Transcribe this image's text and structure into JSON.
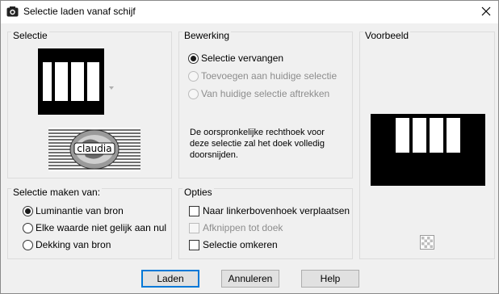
{
  "window": {
    "title": "Selectie laden vanaf schijf"
  },
  "groups": {
    "selectie": {
      "label": "Selectie"
    },
    "bewerking": {
      "label": "Bewerking",
      "options": [
        {
          "label": "Selectie vervangen",
          "checked": true,
          "disabled": false
        },
        {
          "label": "Toevoegen aan huidige selectie",
          "checked": false,
          "disabled": true
        },
        {
          "label": "Van huidige selectie aftrekken",
          "checked": false,
          "disabled": true
        }
      ],
      "description": "De oorspronkelijke rechthoek voor deze selectie zal het doek volledig doorsnijden."
    },
    "voorbeeld": {
      "label": "Voorbeeld"
    },
    "selectie_maken": {
      "label": "Selectie maken van:",
      "options": [
        {
          "label": "Luminantie van bron",
          "checked": true
        },
        {
          "label": "Elke waarde niet gelijk aan nul",
          "checked": false
        },
        {
          "label": "Dekking van bron",
          "checked": false
        }
      ]
    },
    "opties": {
      "label": "Opties",
      "options": [
        {
          "label": "Naar linkerbovenhoek verplaatsen",
          "checked": false,
          "disabled": false
        },
        {
          "label": "Afknippen tot doek",
          "checked": false,
          "disabled": true
        },
        {
          "label": "Selectie omkeren",
          "checked": false,
          "disabled": false
        }
      ]
    }
  },
  "watermark": {
    "text": "claudia"
  },
  "buttons": {
    "load": "Laden",
    "cancel": "Annuleren",
    "help": "Help"
  },
  "colors": {
    "accent": "#0078d7",
    "window_bg": "#f0f0f0"
  }
}
